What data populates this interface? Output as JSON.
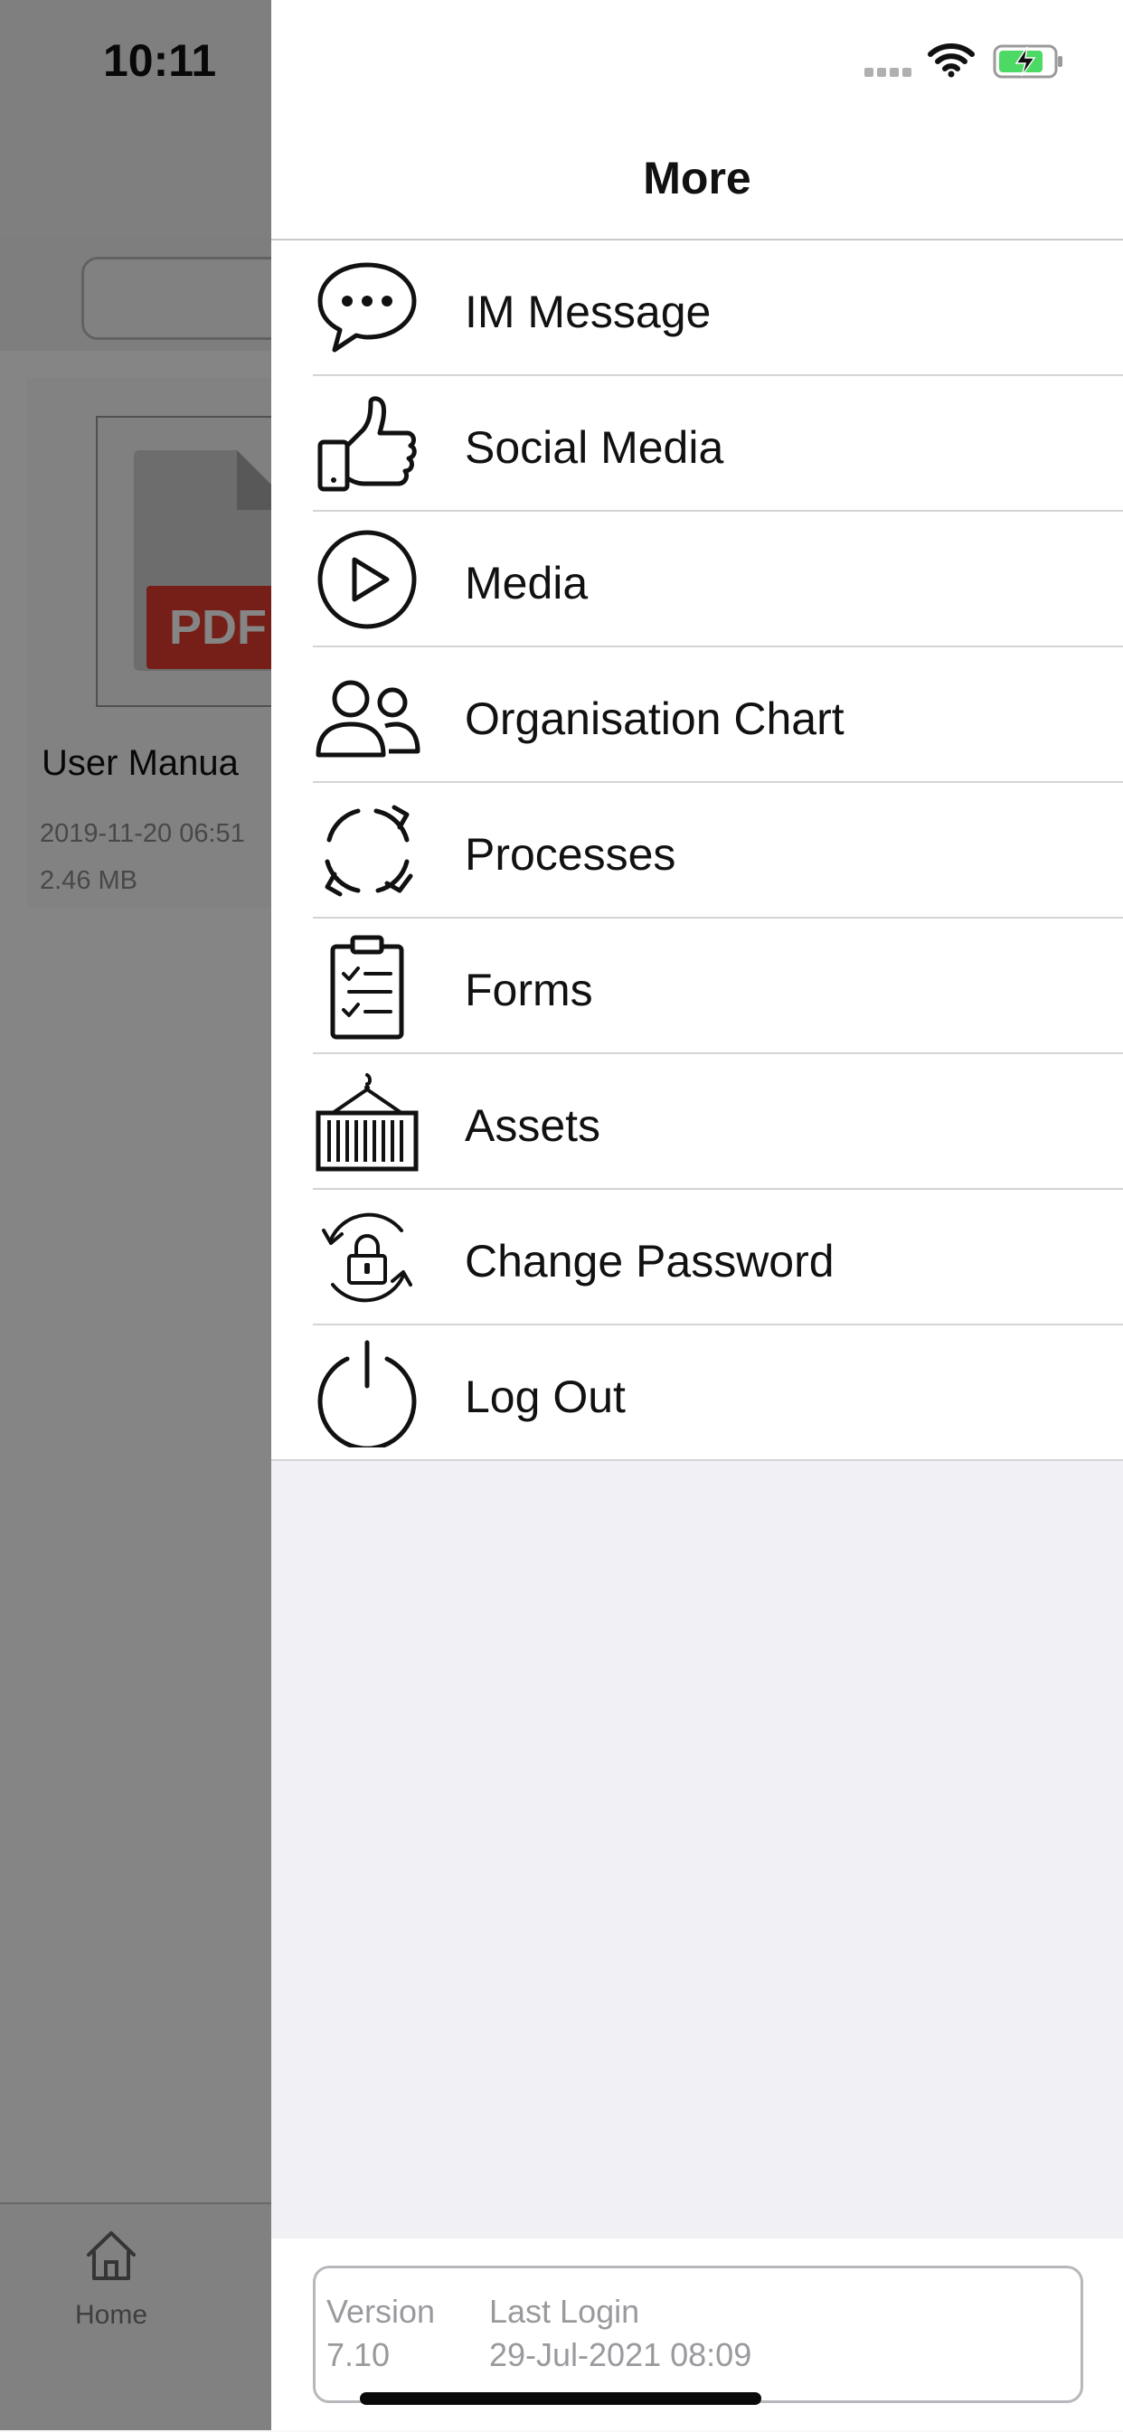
{
  "status_bar": {
    "time": "10:11"
  },
  "background": {
    "document": {
      "badge": "PDF",
      "title": "User Manua",
      "date": "2019-11-20 06:51",
      "size": "2.46 MB"
    },
    "tab_bar": {
      "home_label": "Home",
      "home_icon": "home-icon"
    }
  },
  "drawer": {
    "title": "More",
    "items": [
      {
        "label": "IM Message",
        "icon": "chat-bubble-icon"
      },
      {
        "label": "Social Media",
        "icon": "thumbs-up-icon"
      },
      {
        "label": "Media",
        "icon": "play-icon"
      },
      {
        "label": "Organisation Chart",
        "icon": "people-icon"
      },
      {
        "label": "Processes",
        "icon": "refresh-cycle-icon"
      },
      {
        "label": "Forms",
        "icon": "clipboard-checklist-icon"
      },
      {
        "label": "Assets",
        "icon": "container-icon"
      },
      {
        "label": "Change Password",
        "icon": "lock-rotate-icon"
      },
      {
        "label": "Log Out",
        "icon": "power-icon"
      }
    ]
  },
  "footer": {
    "version_label": "Version",
    "version_value": "7.10",
    "last_login_label": "Last Login",
    "last_login_value": "29-Jul-2021 08:09"
  },
  "colors": {
    "pdf_badge": "#e23c2e",
    "battery_fill": "#4cd964",
    "drawer_background": "#f0f0f5"
  }
}
